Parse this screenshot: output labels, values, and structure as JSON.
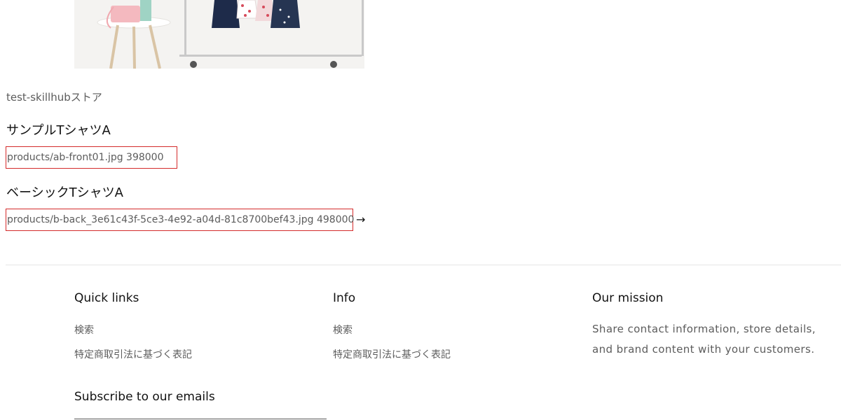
{
  "store": {
    "name": "test-skillhubストア"
  },
  "products": [
    {
      "title": "サンプルTシャツA",
      "info": "products/ab-front01.jpg 398000"
    },
    {
      "title": "ベーシックTシャツA",
      "info": "products/b-back_3e61c43f-5ce3-4e92-a04d-81c8700bef43.jpg 498000"
    }
  ],
  "link_arrow": "→",
  "footer": {
    "quick_links": {
      "heading": "Quick links",
      "items": [
        "検索",
        "特定商取引法に基づく表記"
      ]
    },
    "info": {
      "heading": "Info",
      "items": [
        "検索",
        "特定商取引法に基づく表記"
      ]
    },
    "mission": {
      "heading": "Our mission",
      "text": "Share contact information, store details, and brand content with your customers."
    },
    "subscribe": {
      "heading": "Subscribe to our emails"
    }
  }
}
